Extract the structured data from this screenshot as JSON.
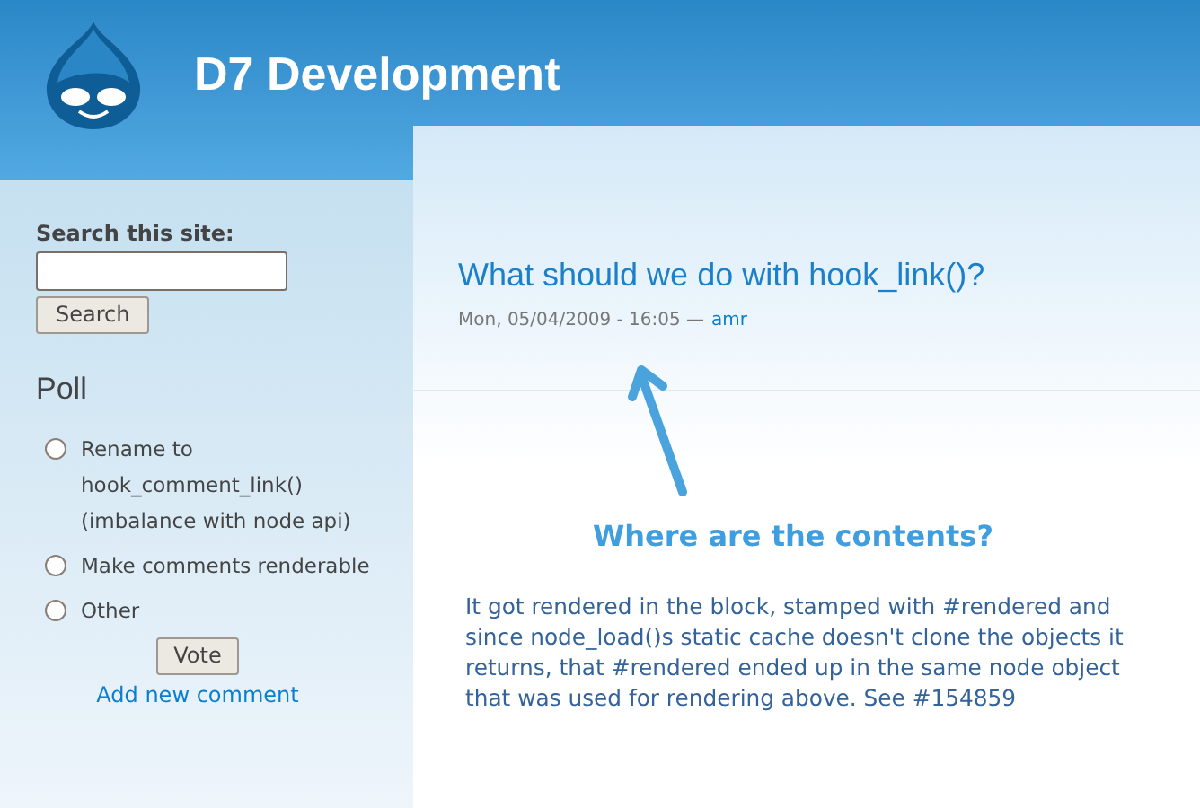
{
  "header": {
    "site_name": "D7 Development"
  },
  "sidebar": {
    "search": {
      "label": "Search this site:",
      "button": "Search"
    },
    "poll": {
      "title": "Poll",
      "options": [
        {
          "label": "Rename to hook_comment_link() (imbalance with node api)",
          "selected": false
        },
        {
          "label": "Make comments renderable",
          "selected": false
        },
        {
          "label": "Other",
          "selected": false
        }
      ],
      "button": "Vote",
      "link": "Add new comment"
    }
  },
  "node": {
    "title": "What should we do with hook_link()?",
    "submitted": "Mon, 05/04/2009 - 16:05 —",
    "author": "amr"
  },
  "annotation": {
    "heading": "Where are the contents?",
    "text": "It got rendered in the block, stamped with #rendered and since node_load()s static cache doesn't clone the objects it returns, that #rendered ended up in the same node object that was used for rendering above. See #154859"
  }
}
